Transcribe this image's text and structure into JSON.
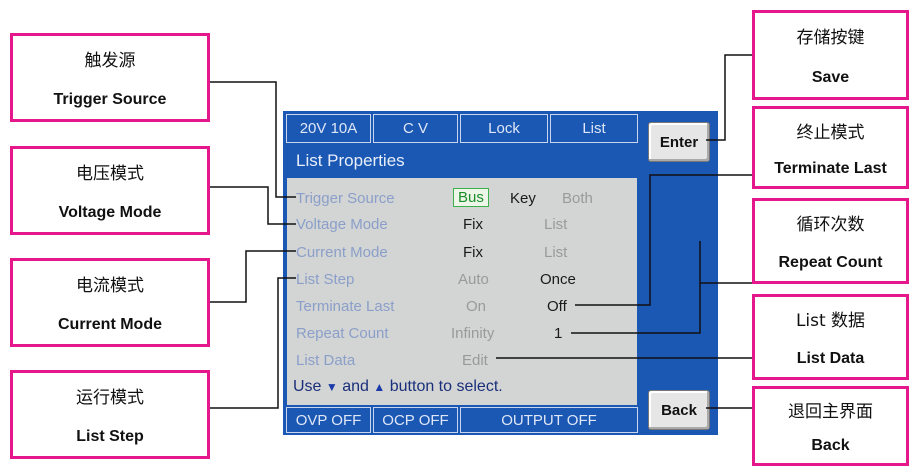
{
  "status_bar": {
    "range": "20V 10A",
    "mode": "C V",
    "lock": "Lock",
    "list": "List"
  },
  "panel_title": "List Properties",
  "rows": [
    {
      "label": "Trigger Source",
      "options": [
        "Bus",
        "Key",
        "Both"
      ]
    },
    {
      "label": "Voltage Mode",
      "options": [
        "Fix",
        "List"
      ]
    },
    {
      "label": "Current Mode",
      "options": [
        "Fix",
        "List"
      ]
    },
    {
      "label": "List Step",
      "options": [
        "Auto",
        "Once"
      ]
    },
    {
      "label": "Terminate Last",
      "options": [
        "On",
        "Off"
      ]
    },
    {
      "label": "Repeat Count",
      "options": [
        "Infinity",
        "1"
      ]
    },
    {
      "label": "List Data",
      "options": [
        "Edit"
      ]
    }
  ],
  "hint": {
    "prefix": "Use",
    "middle": "and",
    "suffix": "button to select."
  },
  "bottom_bar": {
    "ovp": "OVP OFF",
    "ocp": "OCP OFF",
    "output": "OUTPUT OFF"
  },
  "buttons": {
    "enter": "Enter",
    "back": "Back"
  },
  "callouts": {
    "trigger_source": {
      "zh": "触发源",
      "en": "Trigger Source"
    },
    "voltage_mode": {
      "zh": "电压模式",
      "en": "Voltage Mode"
    },
    "current_mode": {
      "zh": "电流模式",
      "en": "Current Mode"
    },
    "list_step": {
      "zh": "运行模式",
      "en": "List Step"
    },
    "save": {
      "zh": "存储按键",
      "en": "Save"
    },
    "terminate_last": {
      "zh": "终止模式",
      "en": "Terminate Last"
    },
    "repeat_count": {
      "zh": "循环次数",
      "en": "Repeat Count"
    },
    "list_data": {
      "zh": "List 数据",
      "en": "List Data"
    },
    "back": {
      "zh": "退回主界面",
      "en": "Back"
    }
  },
  "colors": {
    "screen_blue": "#1a58b4",
    "callout_pink": "#e5178a",
    "selected_green": "#1a8f2a"
  }
}
